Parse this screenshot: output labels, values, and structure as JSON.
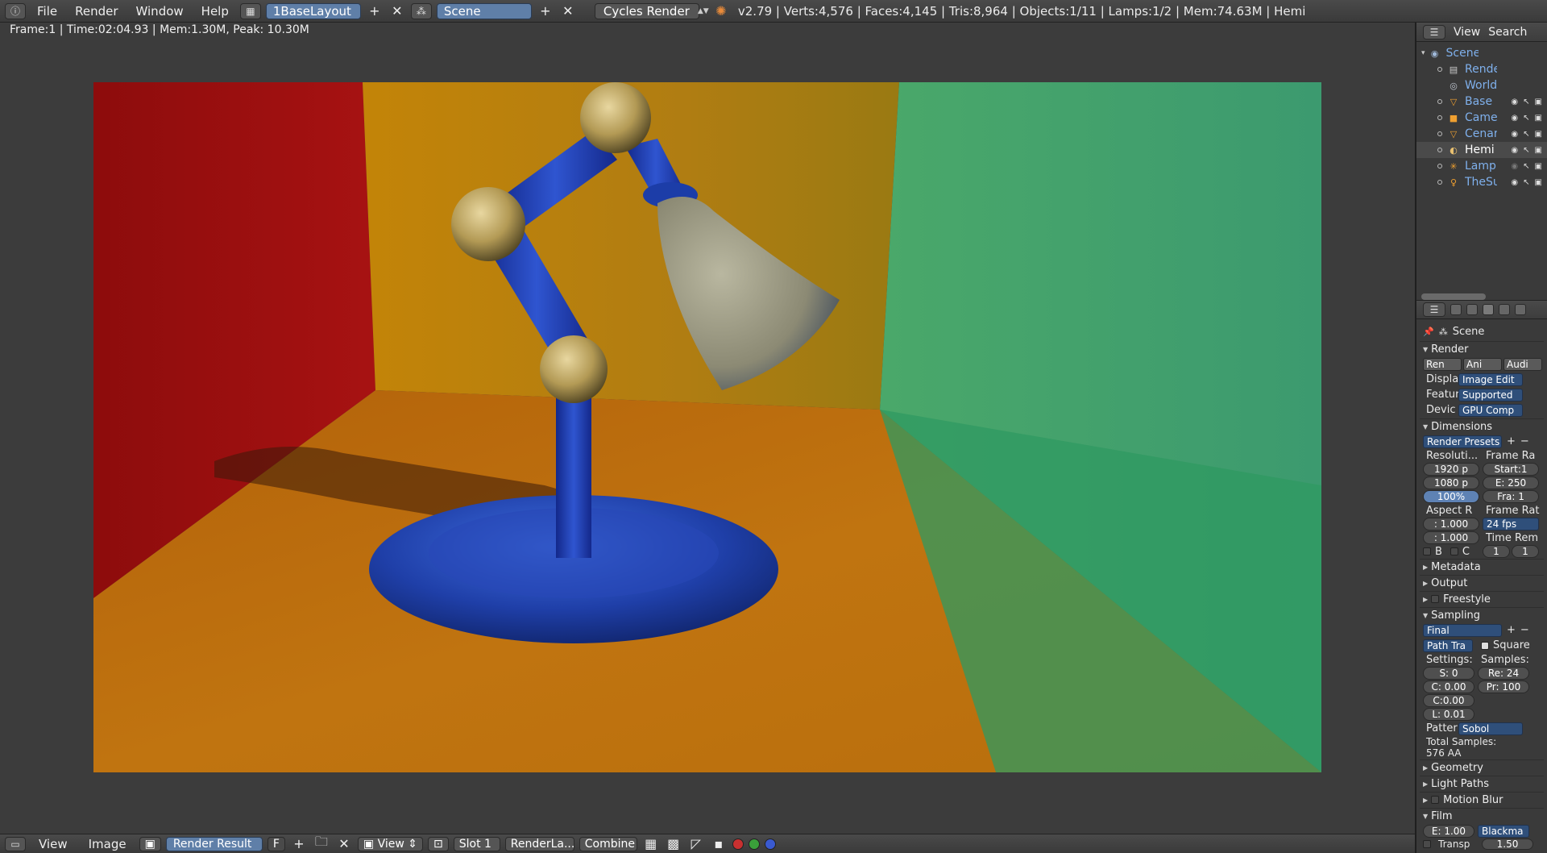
{
  "topbar": {
    "menus": [
      "File",
      "Render",
      "Window",
      "Help"
    ],
    "layout": "1BaseLayout",
    "scene": "Scene",
    "engine": "Cycles Render",
    "stats": "v2.79 | Verts:4,576 | Faces:4,145 | Tris:8,964 | Objects:1/11 | Lamps:1/2 | Mem:74.63M | Hemi"
  },
  "editor": {
    "render_info": "Frame:1 | Time:02:04.93 | Mem:1.30M, Peak: 10.30M"
  },
  "bottombar": {
    "menus": [
      "View",
      "Image"
    ],
    "image_name": "Render Result",
    "fake_user": "F",
    "view_label": "View",
    "slot": "Slot 1",
    "render_layer": "RenderLa...",
    "pass": "Combine"
  },
  "outliner": {
    "header": {
      "view": "View",
      "search": "Search"
    },
    "items": [
      {
        "label": "Scene",
        "icon": "scene-icon"
      },
      {
        "label": "Rende",
        "icon": "render-layers-icon"
      },
      {
        "label": "World",
        "icon": "world-icon"
      },
      {
        "label": "Base",
        "icon": "mesh-icon"
      },
      {
        "label": "Camer",
        "icon": "camera-icon"
      },
      {
        "label": "Cenari",
        "icon": "mesh-icon"
      },
      {
        "label": "Hemi",
        "icon": "lamp-icon"
      },
      {
        "label": "Lamp",
        "icon": "armature-icon"
      },
      {
        "label": "TheSu",
        "icon": "lamp-icon"
      }
    ]
  },
  "properties": {
    "context": "Scene",
    "render": {
      "title": "Render",
      "buttons": [
        "Ren",
        "Ani",
        "Audi"
      ],
      "display_label": "Displa",
      "display_value": "Image Edit",
      "feature_label": "Featur",
      "feature_value": "Supported",
      "device_label": "Devic",
      "device_value": "GPU Comp"
    },
    "dimensions": {
      "title": "Dimensions",
      "presets": "Render Presets",
      "resolution_label": "Resoluti...",
      "res_x": "1920 p",
      "res_y": "1080 p",
      "res_pct": "100%",
      "frame_range_label": "Frame Ra",
      "start": "Start:1",
      "end": "E: 250",
      "step": "Fra: 1",
      "aspect_label": "Aspect R",
      "aspect_x": ": 1.000",
      "aspect_y": ": 1.000",
      "frame_rate_label": "Frame Rat",
      "fps": "24 fps",
      "time_remap_label": "Time Rem",
      "remap_old": "1",
      "remap_new": "1",
      "border_b": "B",
      "border_c": "C"
    },
    "collapsed_1": [
      "Metadata",
      "Output",
      "Freestyle"
    ],
    "sampling": {
      "title": "Sampling",
      "preset": "Final",
      "integrator": "Path Tra",
      "square": "Square",
      "settings_label": "Settings:",
      "samples_label": "Samples:",
      "seed": "S: 0",
      "clamp_direct": "C: 0.00",
      "clamp_indirect": "C:0.00",
      "light_threshold": "L: 0.01",
      "render_samples": "Re: 24",
      "preview_samples": "Pr: 100",
      "pattern_label": "Patter",
      "pattern_value": "Sobol",
      "total_label": "Total Samples:",
      "total_value": "576 AA"
    },
    "collapsed_2": [
      "Geometry",
      "Light Paths",
      "Motion Blur"
    ],
    "film": {
      "title": "Film",
      "exposure": "E: 1.00",
      "filter": "Blackma",
      "transparent": "Transp",
      "width": "1.50"
    }
  },
  "colors": {
    "accent_field": "#5f7fa8",
    "outliner_text": "#7fb0ec",
    "panel_bg": "#3a3a3a"
  }
}
